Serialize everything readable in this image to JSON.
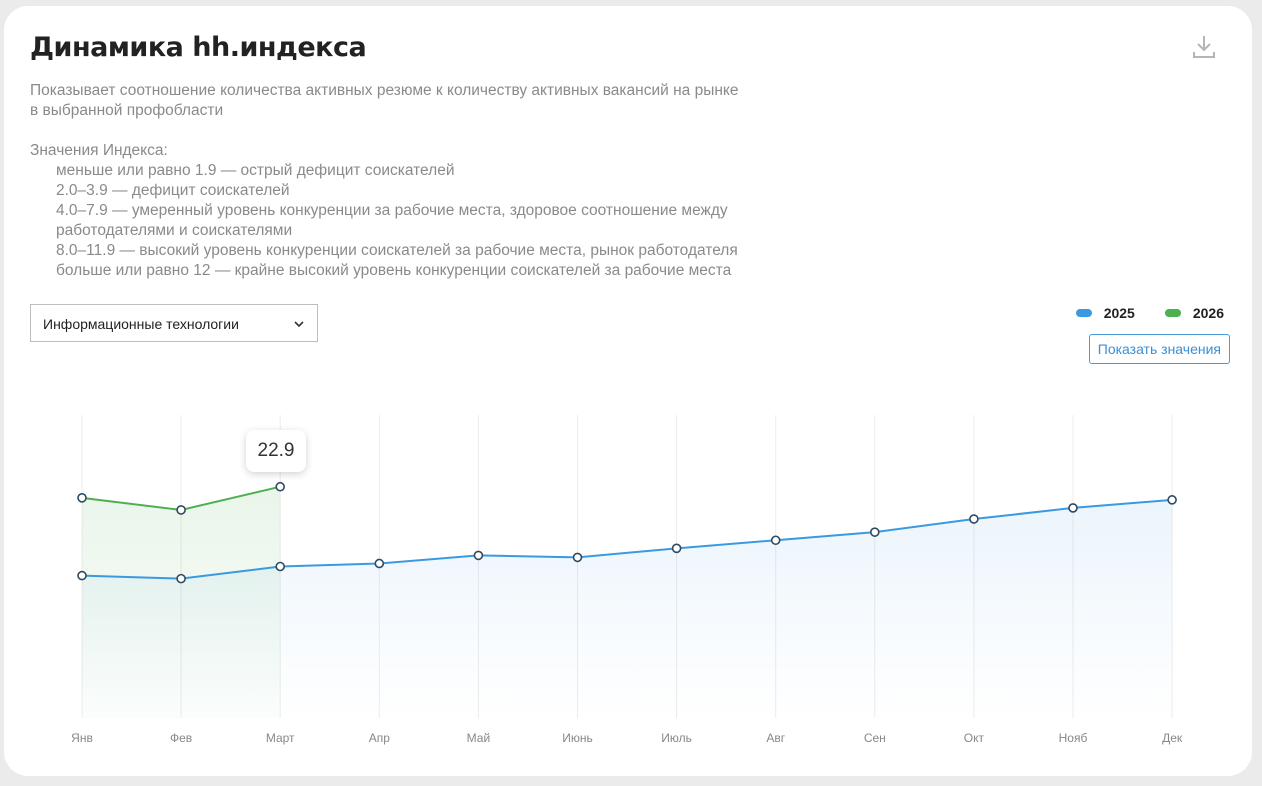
{
  "title": "Динамика hh.индекса",
  "description": {
    "line1": "Показывает соотношение количества активных резюме к количеству активных вакансий на рынке",
    "line2": "в выбранной профобласти",
    "legend_heading": "Значения Индекса:",
    "legend_items": [
      "меньше или равно 1.9 — острый дефицит соискателей",
      "2.0–3.9 — дефицит соискателей",
      "4.0–7.9 — умеренный уровень конкуренции за рабочие места, здоровое соотношение между",
      "работодателями и соискателями",
      "8.0–11.9 — высокий уровень конкуренции соискателей за рабочие места, рынок работодателя",
      "больше или равно 12 — крайне высокий уровень конкуренции соискателей за рабочие места"
    ]
  },
  "filter": {
    "selected": "Информационные технологии"
  },
  "controls": {
    "show_values_label": "Показать значения"
  },
  "icons": {
    "download": "download-icon",
    "chevron": "chevron-down-icon"
  },
  "tooltip": {
    "value": "22.9"
  },
  "colors": {
    "series_2025": "#3b99e0",
    "series_2026": "#4caf50",
    "grid": "#ececec",
    "axis_label": "#888888"
  },
  "chart_data": {
    "type": "area",
    "categories": [
      "Янв",
      "Фев",
      "Март",
      "Апр",
      "Май",
      "Июнь",
      "Июль",
      "Авг",
      "Сен",
      "Окт",
      "Нояб",
      "Дек"
    ],
    "series": [
      {
        "name": "2025",
        "color": "#3b99e0",
        "values": [
          14.1,
          13.8,
          15.0,
          15.3,
          16.1,
          15.9,
          16.8,
          17.6,
          18.4,
          19.7,
          20.8,
          21.6
        ]
      },
      {
        "name": "2026",
        "color": "#4caf50",
        "values": [
          21.8,
          20.6,
          22.9
        ]
      }
    ],
    "ylim": [
      0,
      30
    ],
    "grid": true,
    "legend_position": "top-right",
    "highlighted": {
      "series": "2026",
      "category": "Март",
      "value": 22.9
    }
  }
}
